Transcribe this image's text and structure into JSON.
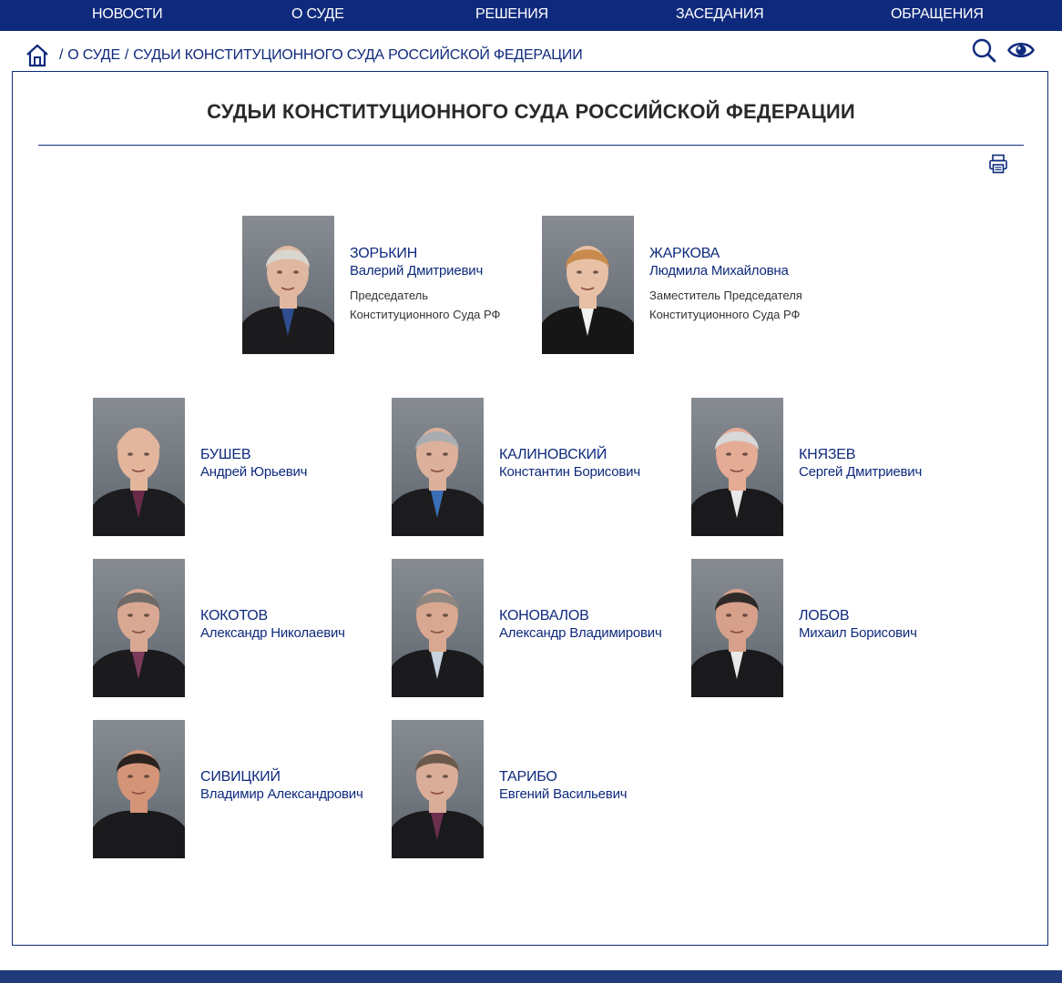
{
  "nav": {
    "items": [
      "НОВОСТИ",
      "О СУДЕ",
      "РЕШЕНИЯ",
      "ЗАСЕДАНИЯ",
      "ОБРАЩЕНИЯ"
    ]
  },
  "breadcrumb": {
    "home_icon": "home-icon",
    "items": [
      "О СУДЕ",
      "СУДЬИ КОНСТИТУЦИОННОГО СУДА РОССИЙСКОЙ ФЕДЕРАЦИИ"
    ],
    "separator": "/"
  },
  "tools": {
    "search_icon": "search-icon",
    "accessibility_icon": "eye-icon"
  },
  "page": {
    "title": "СУДЬИ КОНСТИТУЦИОННОГО СУДА РОССИЙСКОЙ ФЕДЕРАЦИИ",
    "print_icon": "printer-icon"
  },
  "leaders": [
    {
      "surname": "ЗОРЬКИН",
      "given": "Валерий Дмитриевич",
      "role_line1": "Председатель",
      "role_line2": "Конституционного Суда РФ",
      "photo": {
        "hair": "#d9d6d0",
        "skin": "#e0b8a2",
        "robe": "#1b1b1d",
        "accent": "#2f4d8f"
      }
    },
    {
      "surname": "ЖАРКОВА",
      "given": "Людмила Михайловна",
      "role_line1": "Заместитель Председателя",
      "role_line2": "Конституционного Суда РФ",
      "photo": {
        "hair": "#c98a4e",
        "skin": "#e8c0a6",
        "robe": "#161616",
        "accent": "#f2f2f2"
      }
    }
  ],
  "judges": [
    {
      "surname": "БУШЕВ",
      "given": "Андрей Юрьевич",
      "photo": {
        "hair": "#e1b59d",
        "skin": "#e3b69c",
        "robe": "#1c1c1e",
        "accent": "#6a2b4a"
      }
    },
    {
      "surname": "КАЛИНОВСКИЙ",
      "given": "Константин Борисович",
      "photo": {
        "hair": "#a9acb0",
        "skin": "#dcb19b",
        "robe": "#1c1c1e",
        "accent": "#3a6fb7"
      }
    },
    {
      "surname": "КНЯЗЕВ",
      "given": "Сергей Дмитриевич",
      "photo": {
        "hair": "#d8d8d8",
        "skin": "#e4ab95",
        "robe": "#1a1a1c",
        "accent": "#e9e9e9"
      }
    },
    {
      "surname": "КОКОТОВ",
      "given": "Александр Николаевич",
      "photo": {
        "hair": "#6d6a68",
        "skin": "#d9a892",
        "robe": "#1b1b1d",
        "accent": "#7a3c5a"
      }
    },
    {
      "surname": "КОНОВАЛОВ",
      "given": "Александр Владимирович",
      "photo": {
        "hair": "#8b8680",
        "skin": "#d9a890",
        "robe": "#1b1b1d",
        "accent": "#c7d3de"
      }
    },
    {
      "surname": "ЛОБОВ",
      "given": "Михаил Борисович",
      "photo": {
        "hair": "#2e2a28",
        "skin": "#d7a08a",
        "robe": "#1a1a1c",
        "accent": "#e8e8e8"
      }
    },
    {
      "surname": "СИВИЦКИЙ",
      "given": "Владимир Александрович",
      "photo": {
        "hair": "#2a221e",
        "skin": "#d39478",
        "robe": "#1a1a1c",
        "accent": "#1a1a1c"
      }
    },
    {
      "surname": "ТАРИБО",
      "given": "Евгений Васильевич",
      "photo": {
        "hair": "#6b5a4c",
        "skin": "#d9ad98",
        "robe": "#1a1a1c",
        "accent": "#6b2e4d"
      }
    }
  ]
}
